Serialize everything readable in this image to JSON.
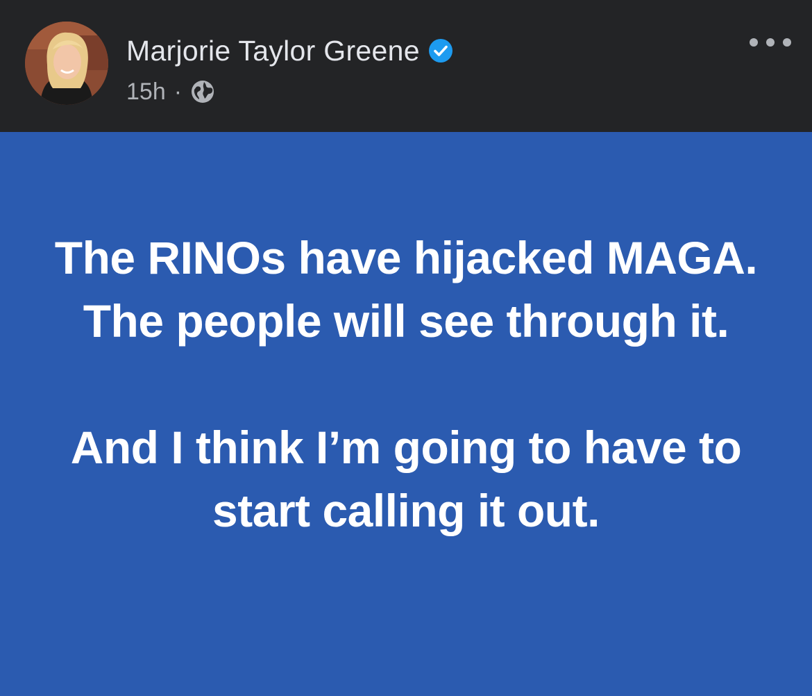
{
  "post": {
    "author_name": "Marjorie Taylor Greene",
    "verified": true,
    "timestamp": "15h",
    "separator": "·",
    "audience_icon": "globe-icon",
    "more_icon": "more-options-icon",
    "paragraphs": [
      "The RINOs have hijacked MAGA. The people will see through it.",
      "And I think I’m going to have to start calling it out."
    ]
  },
  "colors": {
    "header_bg": "#232426",
    "post_bg": "#2b5bb0",
    "verified_badge": "#1d9bf0",
    "post_text": "#ffffff"
  }
}
